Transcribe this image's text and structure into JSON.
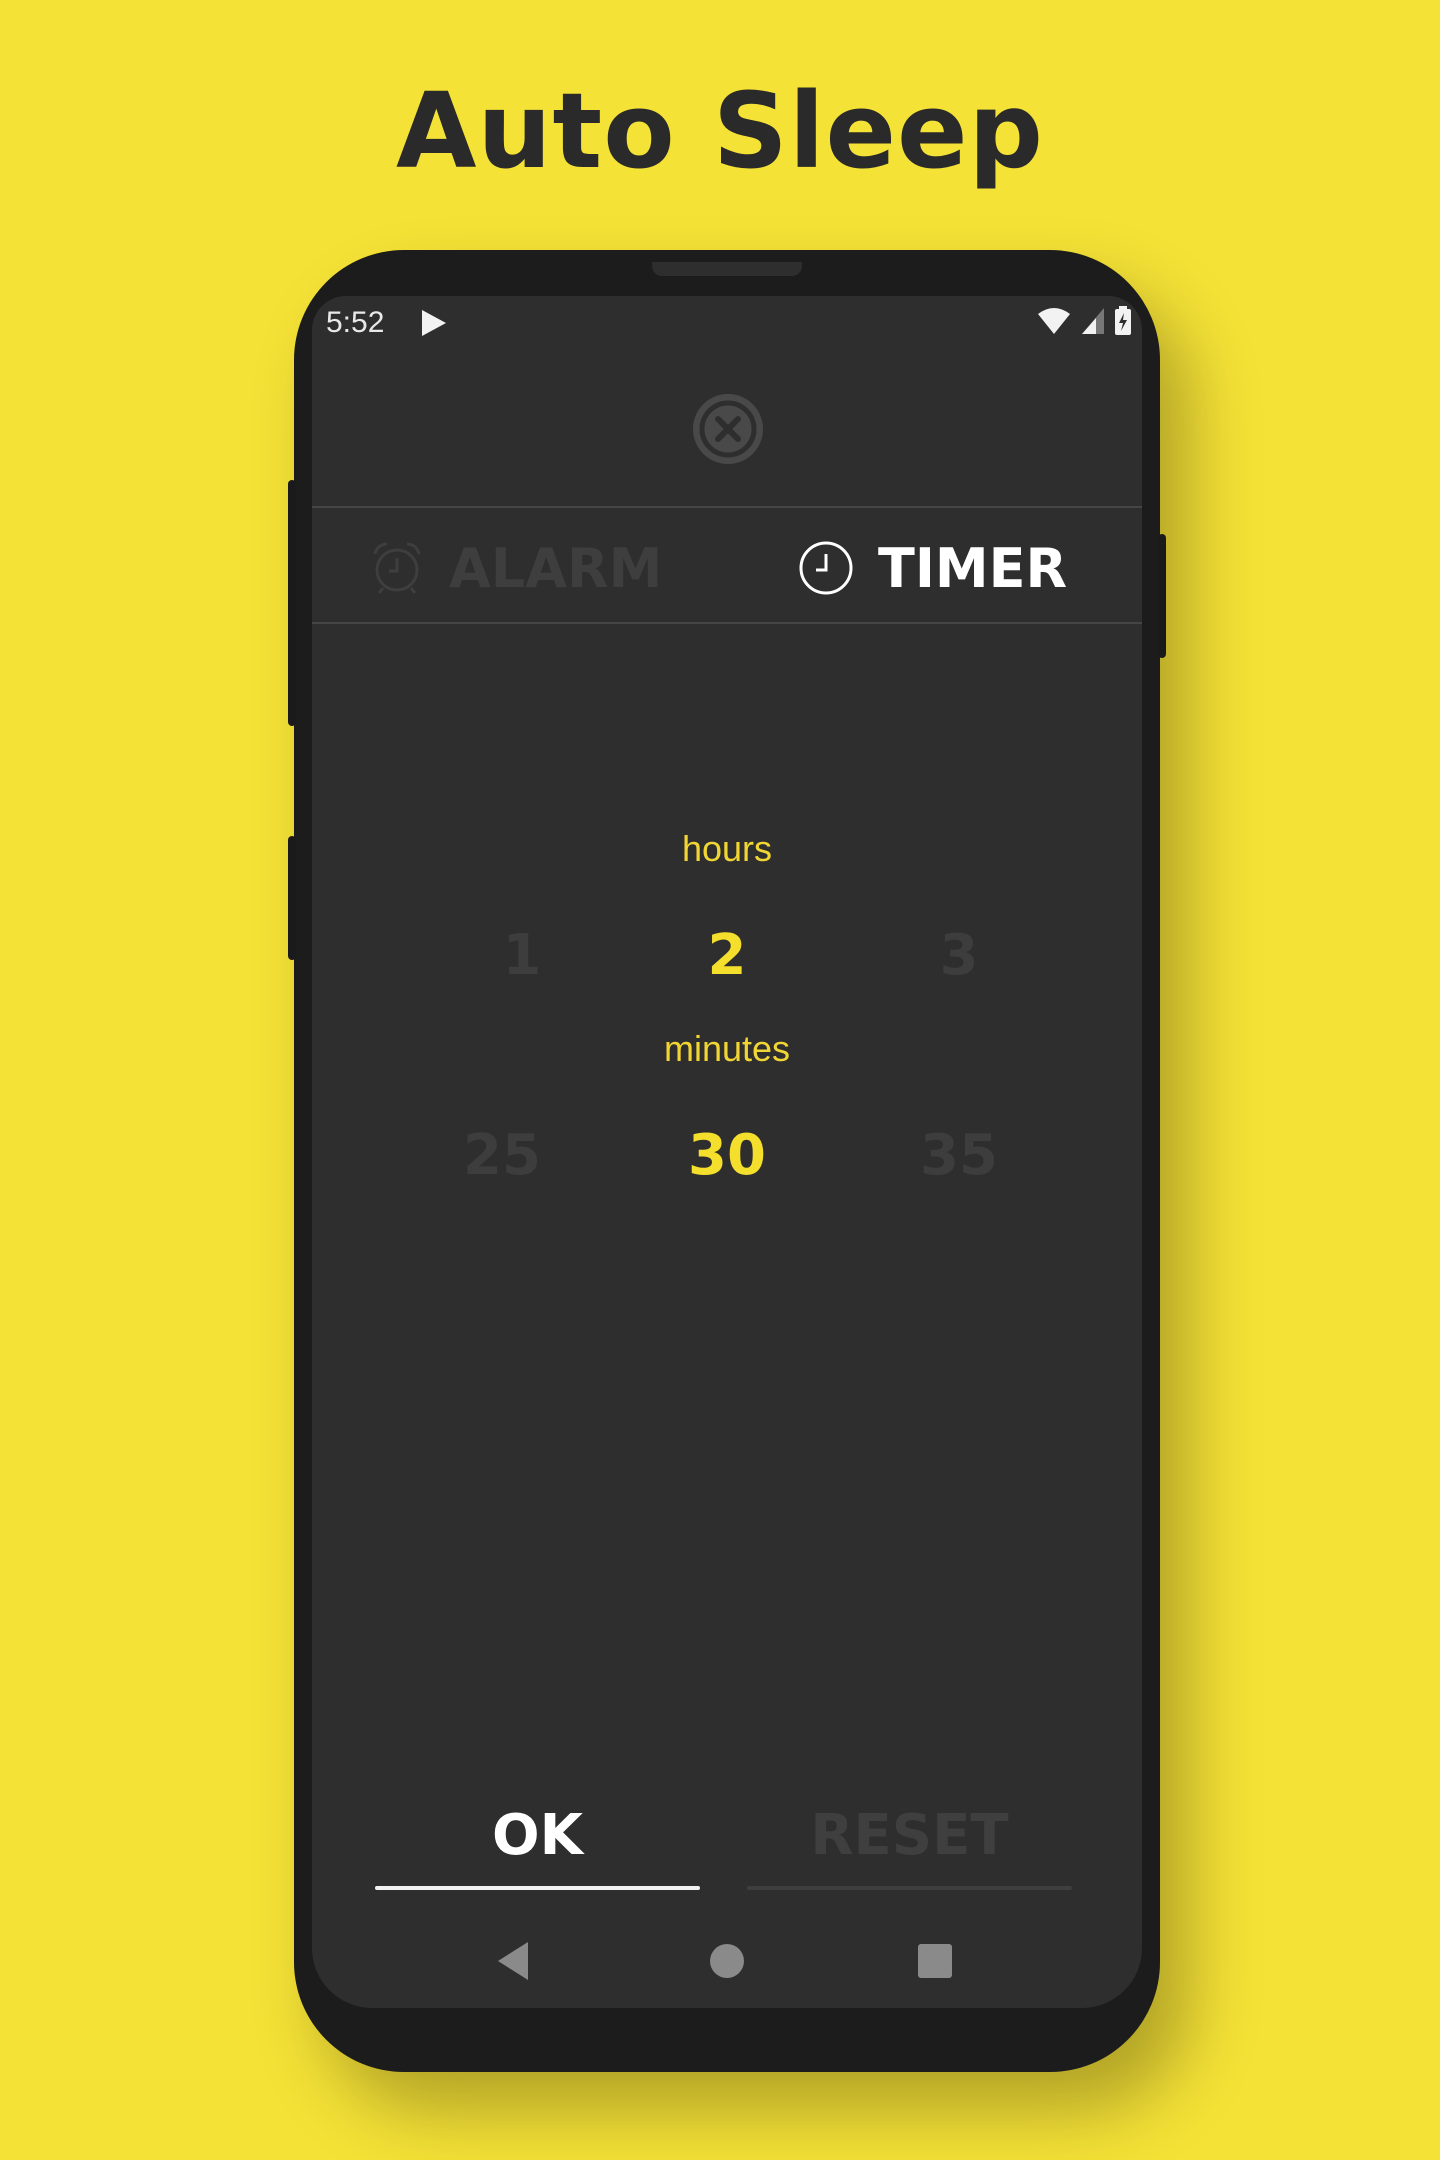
{
  "headline": "Auto Sleep",
  "status_bar": {
    "time": "5:52",
    "icons": [
      "play-icon",
      "wifi-icon",
      "signal-icon",
      "battery-charging-icon"
    ]
  },
  "close": {
    "icon": "close-icon"
  },
  "tabs": [
    {
      "label": "ALARM",
      "icon": "alarm-clock-icon",
      "active": false
    },
    {
      "label": "TIMER",
      "icon": "clock-icon",
      "active": true
    }
  ],
  "picker": {
    "hours": {
      "label": "hours",
      "prev": "1",
      "selected": "2",
      "next": "3"
    },
    "minutes": {
      "label": "minutes",
      "prev": "25",
      "selected": "30",
      "next": "35"
    }
  },
  "actions": {
    "ok_label": "OK",
    "reset_label": "RESET"
  },
  "nav": [
    "back-icon",
    "home-icon",
    "recents-icon"
  ],
  "colors": {
    "background": "#f5e236",
    "screen": "#2e2e2e",
    "accent": "#f3df2c",
    "active_text": "#ffffff",
    "inactive_text": "#3e3e3e"
  }
}
